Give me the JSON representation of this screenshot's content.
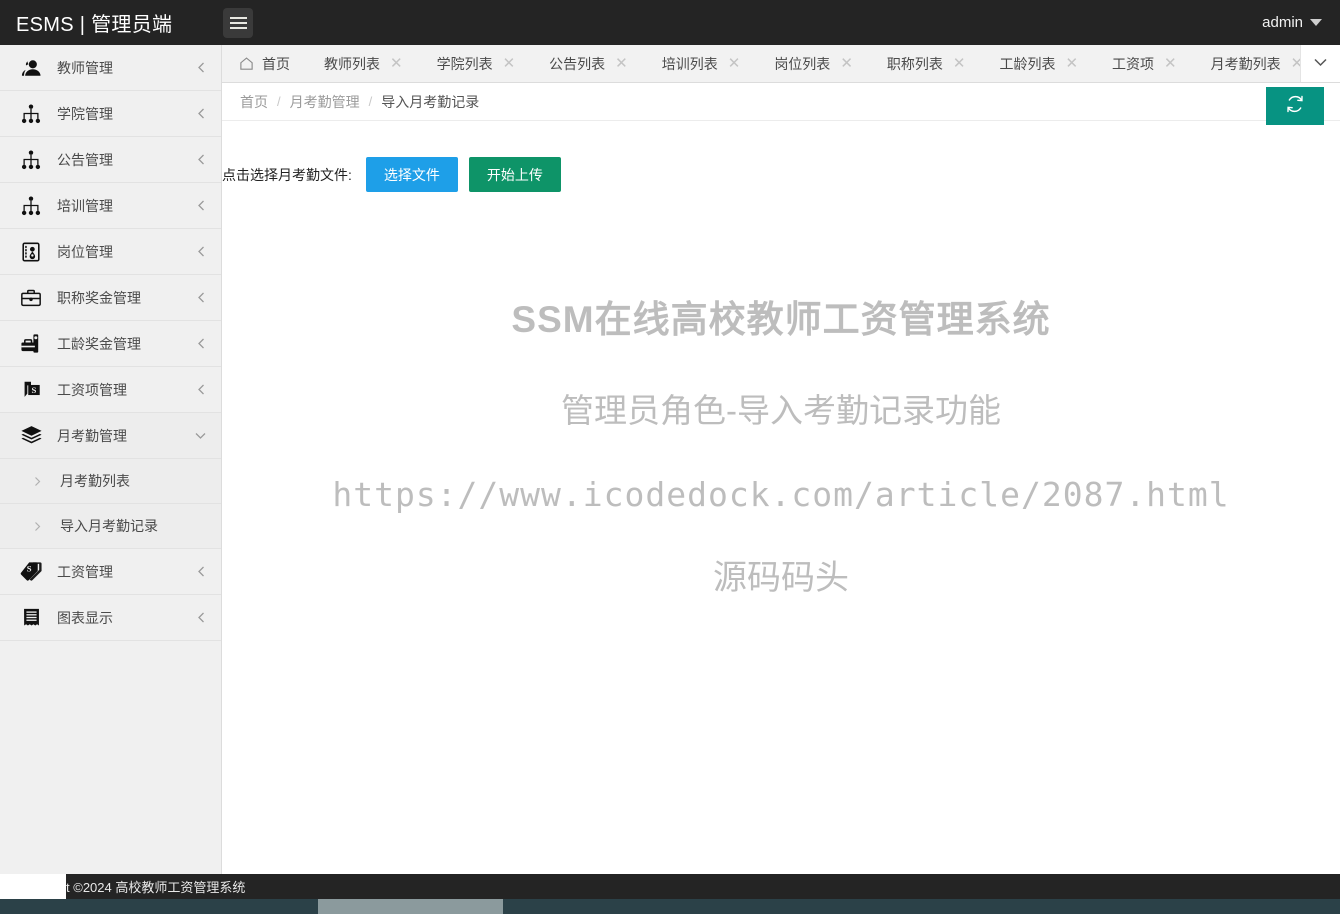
{
  "header": {
    "brand": "ESMS | 管理员端",
    "menu_toggle_icon": "hamburger-icon",
    "user": "admin",
    "user_caret_icon": "caret-down-icon"
  },
  "sidebar": {
    "items": [
      {
        "label": "教师管理",
        "icon": "users-icon",
        "arrow": "chevron-left-icon",
        "expanded": false
      },
      {
        "label": "学院管理",
        "icon": "sitemap-icon",
        "arrow": "chevron-left-icon",
        "expanded": false
      },
      {
        "label": "公告管理",
        "icon": "sitemap-icon",
        "arrow": "chevron-left-icon",
        "expanded": false
      },
      {
        "label": "培训管理",
        "icon": "sitemap-icon",
        "arrow": "chevron-left-icon",
        "expanded": false
      },
      {
        "label": "岗位管理",
        "icon": "id-badge-icon",
        "arrow": "chevron-left-icon",
        "expanded": false
      },
      {
        "label": "职称奖金管理",
        "icon": "briefcase-icon",
        "arrow": "chevron-left-icon",
        "expanded": false
      },
      {
        "label": "工龄奖金管理",
        "icon": "toolbox-icon",
        "arrow": "chevron-left-icon",
        "expanded": false
      },
      {
        "label": "工资项管理",
        "icon": "money-note-icon",
        "arrow": "chevron-left-icon",
        "expanded": false
      },
      {
        "label": "月考勤管理",
        "icon": "layers-icon",
        "arrow": "chevron-down-icon",
        "expanded": true
      },
      {
        "label": "工资管理",
        "icon": "tags-icon",
        "arrow": "chevron-left-icon",
        "expanded": false
      },
      {
        "label": "图表显示",
        "icon": "receipt-icon",
        "arrow": "chevron-left-icon",
        "expanded": false
      }
    ],
    "subitems": [
      {
        "label": "月考勤列表",
        "icon": "chevron-right-icon"
      },
      {
        "label": "导入月考勤记录",
        "icon": "chevron-right-icon"
      }
    ]
  },
  "tabs": {
    "home": {
      "label": "首页",
      "icon": "home-icon"
    },
    "items": [
      {
        "label": "教师列表",
        "close_icon": "close-icon"
      },
      {
        "label": "学院列表",
        "close_icon": "close-icon"
      },
      {
        "label": "公告列表",
        "close_icon": "close-icon"
      },
      {
        "label": "培训列表",
        "close_icon": "close-icon"
      },
      {
        "label": "岗位列表",
        "close_icon": "close-icon"
      },
      {
        "label": "职称列表",
        "close_icon": "close-icon"
      },
      {
        "label": "工龄列表",
        "close_icon": "close-icon"
      },
      {
        "label": "工资项",
        "close_icon": "close-icon"
      },
      {
        "label": "月考勤列表",
        "close_icon": "close-icon"
      }
    ],
    "overflow_icon": "chevron-down-icon"
  },
  "breadcrumb": {
    "items": [
      "首页",
      "月考勤管理",
      "导入月考勤记录"
    ],
    "separator": "/",
    "refresh_icon": "refresh-icon"
  },
  "main": {
    "upload_label": "点击选择月考勤文件:",
    "select_file_button": "选择文件",
    "start_upload_button": "开始上传"
  },
  "watermark": {
    "line1": "SSM在线高校教师工资管理系统",
    "line2": "管理员角色-导入考勤记录功能",
    "line3": "https://www.icodedock.com/article/2087.html",
    "line4": "源码码头"
  },
  "footer": {
    "text": "Copyright ©2024 高校教师工资管理系统"
  },
  "colors": {
    "topbar_bg": "#242424",
    "sidebar_bg": "#f0f0f0",
    "accent_blue": "#1e9fe8",
    "accent_green": "#0e9468",
    "accent_teal": "#079382",
    "watermark_gray": "#bdbdbd"
  }
}
